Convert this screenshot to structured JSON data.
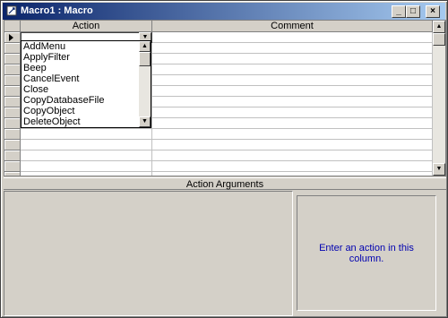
{
  "window": {
    "title": "Macro1 : Macro",
    "minimize_glyph": "_",
    "maximize_glyph": "□",
    "close_glyph": "×"
  },
  "grid": {
    "columns": [
      "Action",
      "Comment"
    ],
    "current_row_action_value": "",
    "row_count_visible": 15
  },
  "action_dropdown": {
    "items": [
      "AddMenu",
      "ApplyFilter",
      "Beep",
      "CancelEvent",
      "Close",
      "CopyDatabaseFile",
      "CopyObject",
      "DeleteObject"
    ],
    "open_glyph": "▼",
    "scroll_up_glyph": "▲",
    "scroll_down_glyph": "▼"
  },
  "grid_scrollbar": {
    "up_glyph": "▲",
    "down_glyph": "▼"
  },
  "action_arguments": {
    "label": "Action Arguments",
    "help_text": "Enter an action in this column."
  }
}
